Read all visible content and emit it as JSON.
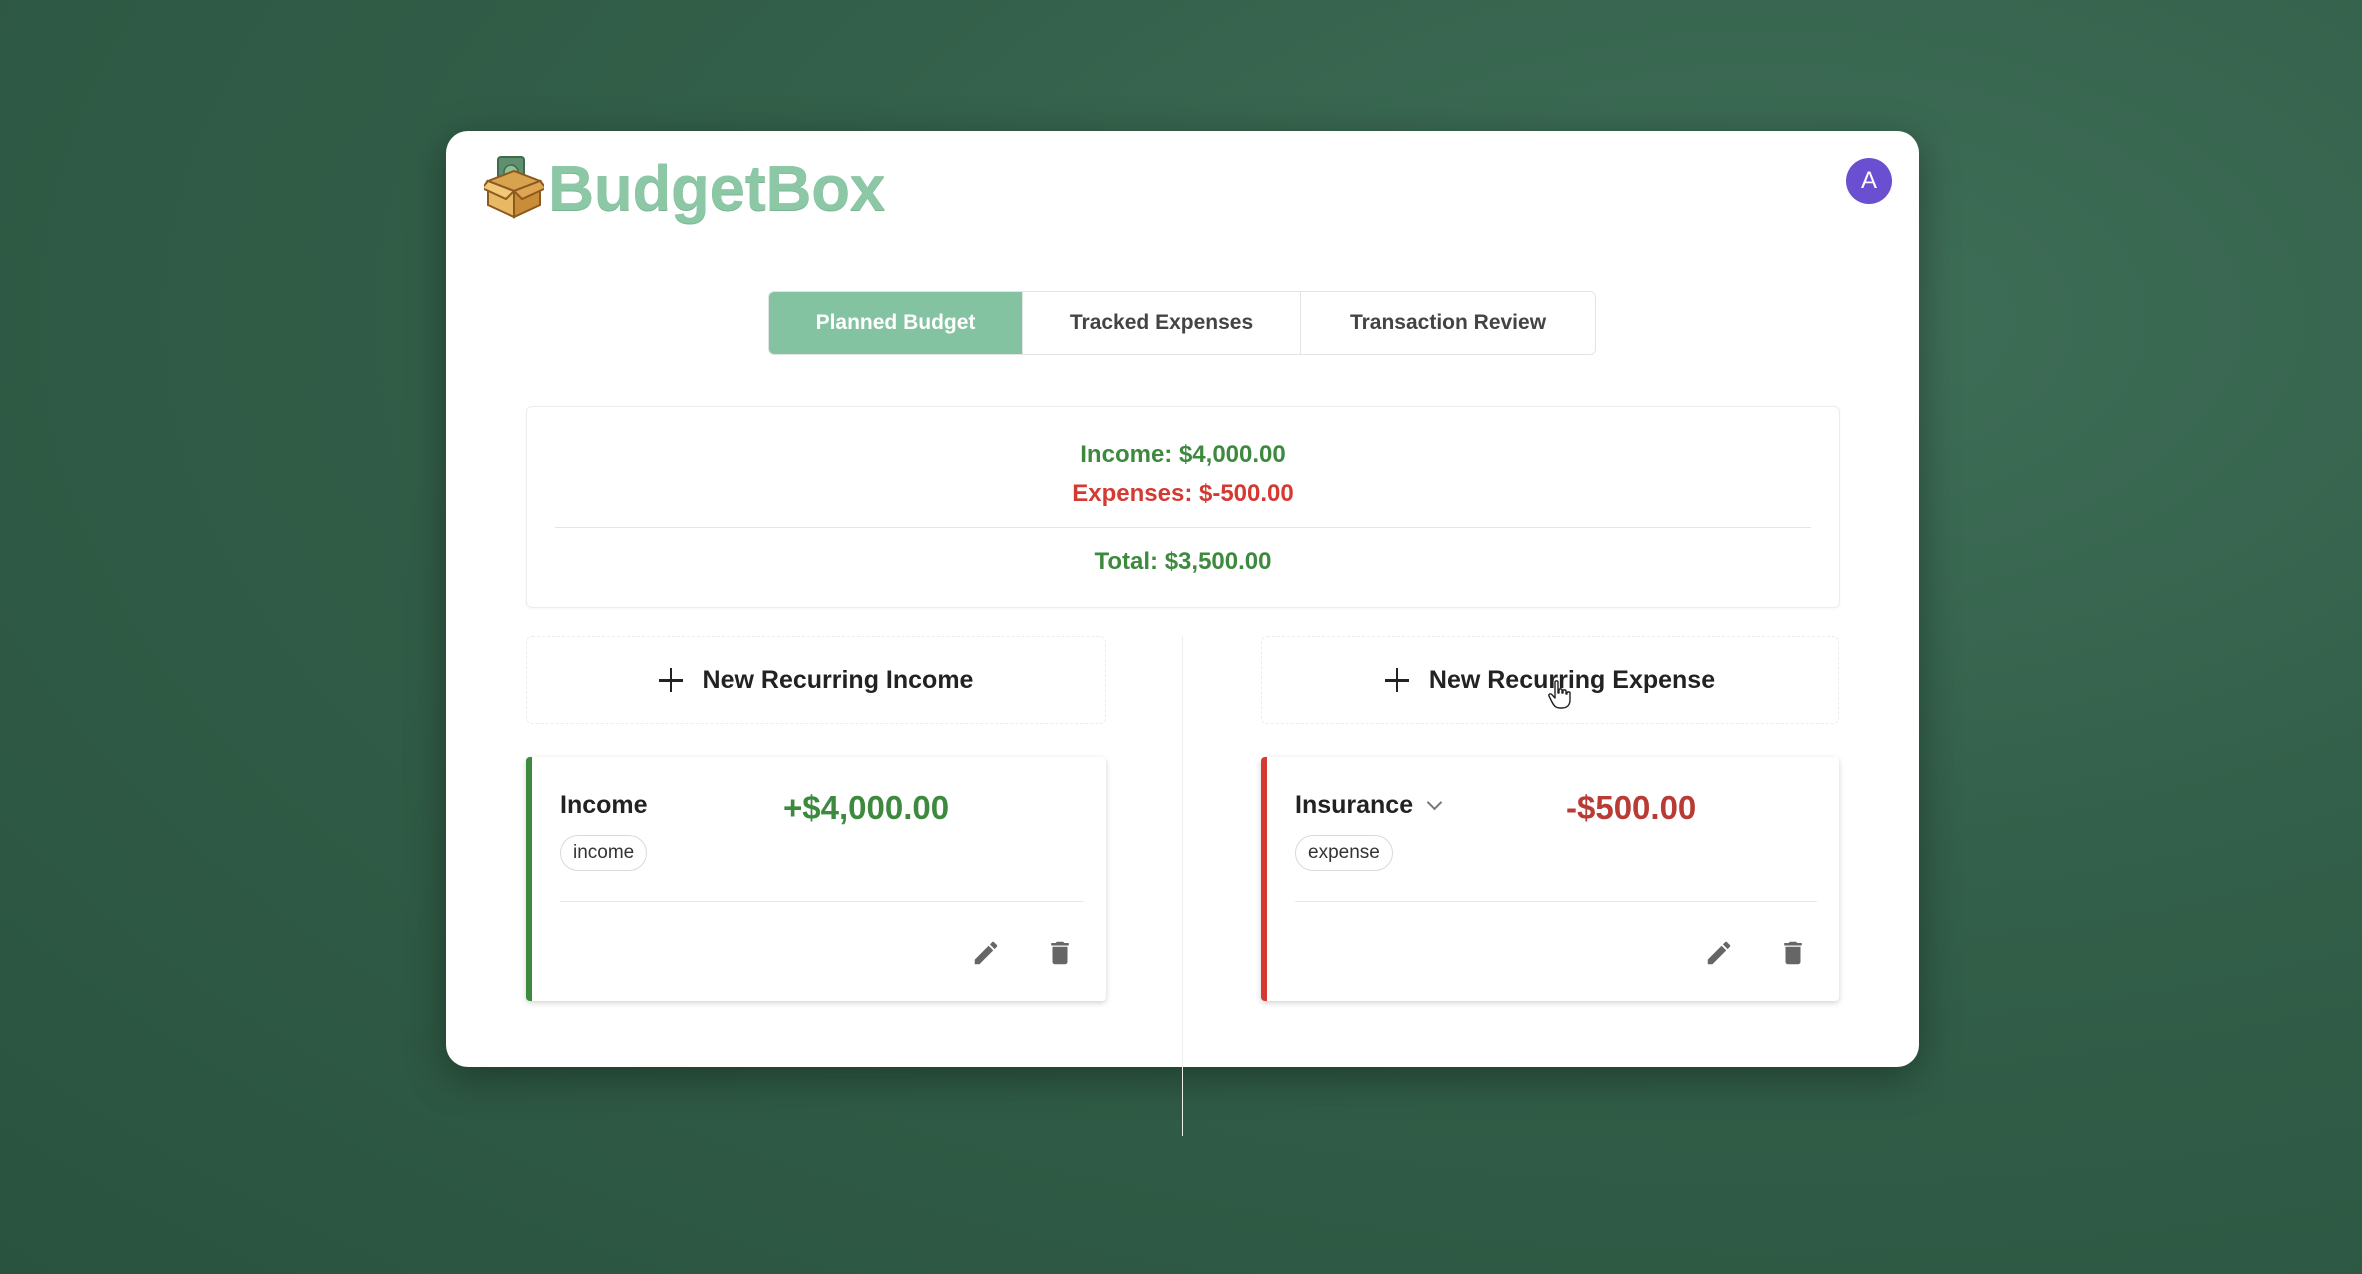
{
  "app": {
    "name": "BudgetBox",
    "avatar_initial": "A",
    "brand_color": "#8cc7a6",
    "avatar_color": "#6a4fd1"
  },
  "tabs": [
    {
      "label": "Planned Budget",
      "active": true
    },
    {
      "label": "Tracked Expenses",
      "active": false
    },
    {
      "label": "Transaction Review",
      "active": false
    }
  ],
  "summary": {
    "income": "Income: $4,000.00",
    "expenses": "Expenses: $-500.00",
    "total": "Total: $3,500.00",
    "income_color": "#3d8a3f",
    "expense_color": "#d43a32"
  },
  "actions": {
    "new_income": "New Recurring Income",
    "new_expense": "New Recurring Expense"
  },
  "income_items": [
    {
      "name": "Income",
      "amount": "+$4,000.00",
      "tag": "income"
    }
  ],
  "expense_items": [
    {
      "name": "Insurance",
      "amount": "-$500.00",
      "tag": "expense"
    }
  ],
  "icons": {
    "logo": "box-money-icon",
    "add": "plus-icon",
    "edit": "pencil-icon",
    "delete": "trash-icon",
    "expand": "chevron-down-icon"
  }
}
